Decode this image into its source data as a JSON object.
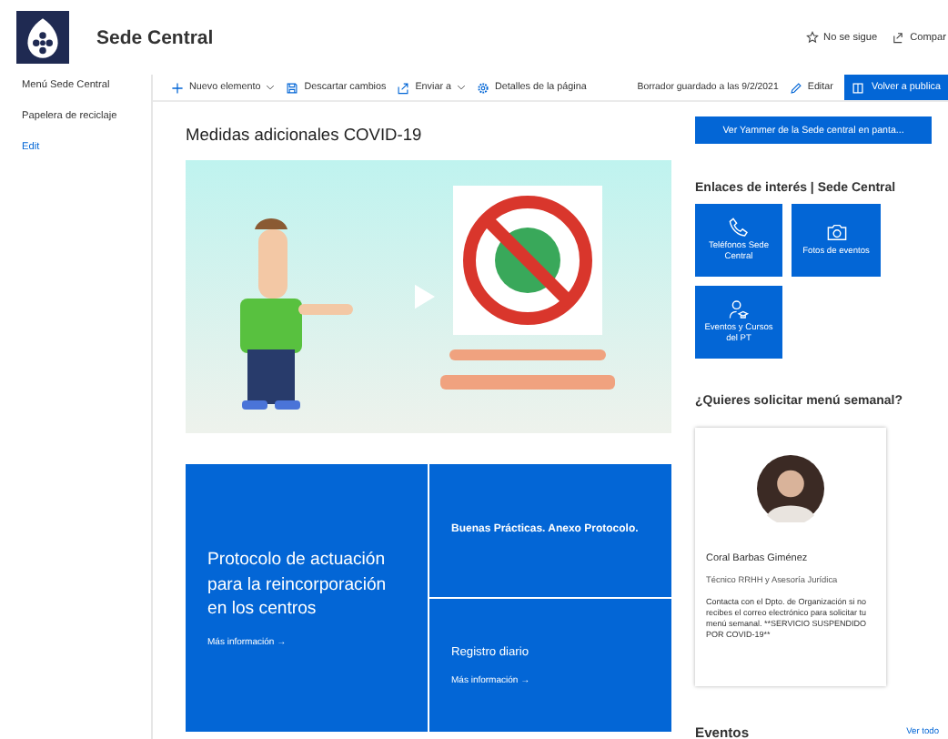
{
  "header": {
    "site_title": "Sede Central",
    "actions": [
      {
        "label": "No se sigue"
      },
      {
        "label": "Compar"
      }
    ]
  },
  "sidebar": {
    "items": [
      {
        "label": "Menú Sede Central",
        "kind": "nav"
      },
      {
        "label": "Papelera de reciclaje",
        "kind": "nav"
      },
      {
        "label": "Edit",
        "kind": "link"
      }
    ]
  },
  "command_bar": {
    "items": [
      {
        "label": "Nuevo elemento",
        "dropdown": true
      },
      {
        "label": "Descartar cambios",
        "dropdown": false
      },
      {
        "label": "Enviar a",
        "dropdown": true
      },
      {
        "label": "Detalles de la página",
        "dropdown": false
      }
    ],
    "status": "Borrador guardado a las 9/2/2021",
    "edit": "Editar",
    "publish": "Volver a publica"
  },
  "main": {
    "title": "Medidas adicionales COVID-19",
    "tiles": [
      {
        "kind": "large",
        "title": "Protocolo de actuación para la reincorporación en los centros",
        "link": "Más información →"
      },
      {
        "kind": "small",
        "title": "Buenas Prácticas. Anexo Protocolo."
      },
      {
        "kind": "small",
        "title": "Registro diario",
        "link": "Más información →"
      }
    ]
  },
  "right": {
    "yammer_button": "Ver Yammer de la Sede central en panta...",
    "links_title": "Enlaces de interés | Sede Central",
    "quick_links": [
      {
        "label": "Teléfonos Sede Central"
      },
      {
        "label": "Fotos de eventos"
      },
      {
        "label": "Eventos y Cursos del PT"
      }
    ],
    "contact_title": "¿Quieres solicitar menú semanal?",
    "contact": {
      "name": "Coral Barbas Giménez",
      "role": "Técnico RRHH y Asesoría Jurídica",
      "note": "Contacta con el Dpto. de Organización si no recibes el correo electrónico para solicitar tu menú semanal. **SERVICIO SUSPENDIDO POR COVID-19**"
    },
    "events_title": "Eventos",
    "see_all": "Ver todo"
  }
}
